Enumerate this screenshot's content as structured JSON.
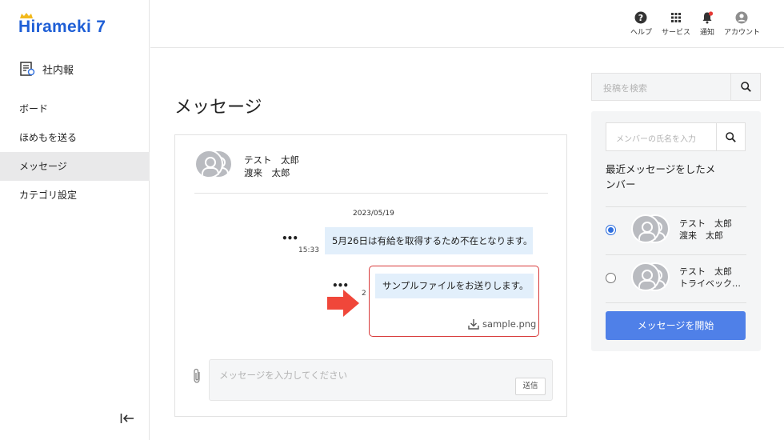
{
  "app": {
    "logo_text": "Hirameki 7",
    "title": "社内報"
  },
  "sidebar": {
    "items": [
      {
        "label": "ボード"
      },
      {
        "label": "ほめもを送る"
      },
      {
        "label": "メッセージ"
      },
      {
        "label": "カテゴリ設定"
      }
    ],
    "active": "メッセージ"
  },
  "topbar": {
    "items": [
      {
        "label": "ヘルプ",
        "icon": "help-icon"
      },
      {
        "label": "サービス",
        "icon": "grid-icon"
      },
      {
        "label": "通知",
        "icon": "bell-icon"
      },
      {
        "label": "アカウント",
        "icon": "account-icon"
      }
    ]
  },
  "page": {
    "title": "メッセージ"
  },
  "conversation": {
    "participants": [
      "テスト　太郎",
      "渡来　太郎"
    ],
    "date": "2023/05/19",
    "messages": [
      {
        "text": "5月26日は有給を取得するため不在となります。",
        "time": "15:33"
      },
      {
        "text": "サンプルファイルをお送りします。",
        "time": "2",
        "attachment": "sample.png"
      }
    ],
    "input_placeholder": "メッセージを入力してください",
    "send_label": "送信"
  },
  "search": {
    "placeholder": "投稿を検索"
  },
  "member_panel": {
    "search_placeholder": "メンバーの氏名を入力",
    "title": "最近メッセージをしたメンバー",
    "members": [
      {
        "names": [
          "テスト　太郎",
          "渡来　太郎"
        ],
        "selected": true
      },
      {
        "names": [
          "テスト　太郎",
          "トライベック…"
        ],
        "selected": false
      }
    ],
    "start_button": "メッセージを開始"
  },
  "colors": {
    "brand": "#1f5fd6",
    "accent_button": "#4f80e8",
    "bubble": "#e2effb",
    "highlight": "#d83a3a",
    "arrow": "#f0473a"
  }
}
